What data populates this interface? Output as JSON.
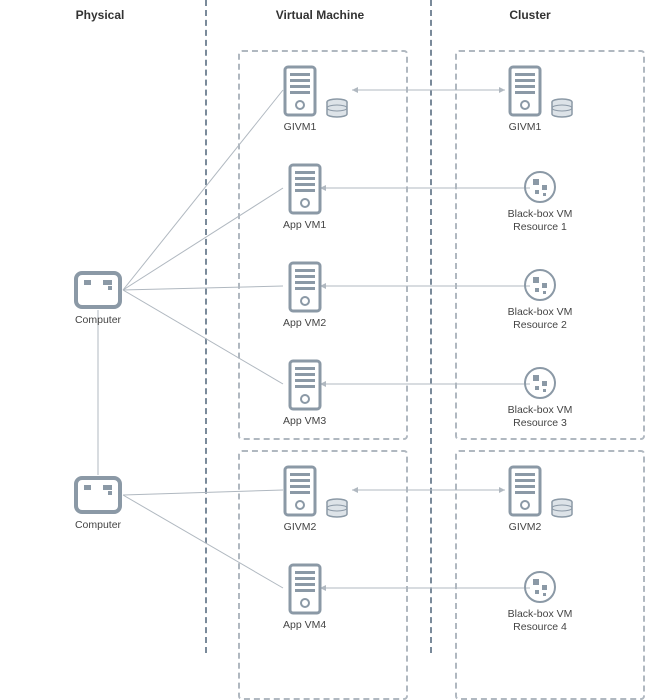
{
  "headers": {
    "physical": "Physical",
    "vm": "Virtual Machine",
    "cluster": "Cluster"
  },
  "nodes": {
    "computer1": "Computer",
    "computer2": "Computer",
    "givm1_vm": "GIVM1",
    "app_vm1": "App VM1",
    "app_vm2": "App VM2",
    "app_vm3": "App VM3",
    "givm2_vm": "GIVM2",
    "app_vm4": "App VM4",
    "givm1_cl": "GIVM1",
    "bbvm1_l1": "Black-box VM",
    "bbvm1_l2": "Resource 1",
    "bbvm2_l1": "Black-box VM",
    "bbvm2_l2": "Resource 2",
    "bbvm3_l1": "Black-box VM",
    "bbvm3_l2": "Resource 3",
    "givm2_cl": "GIVM2",
    "bbvm4_l1": "Black-box VM",
    "bbvm4_l2": "Resource 4"
  },
  "colors": {
    "icon_main": "#8b99a6",
    "icon_light": "#cfd6dd",
    "divider": "#7a8a9a"
  }
}
